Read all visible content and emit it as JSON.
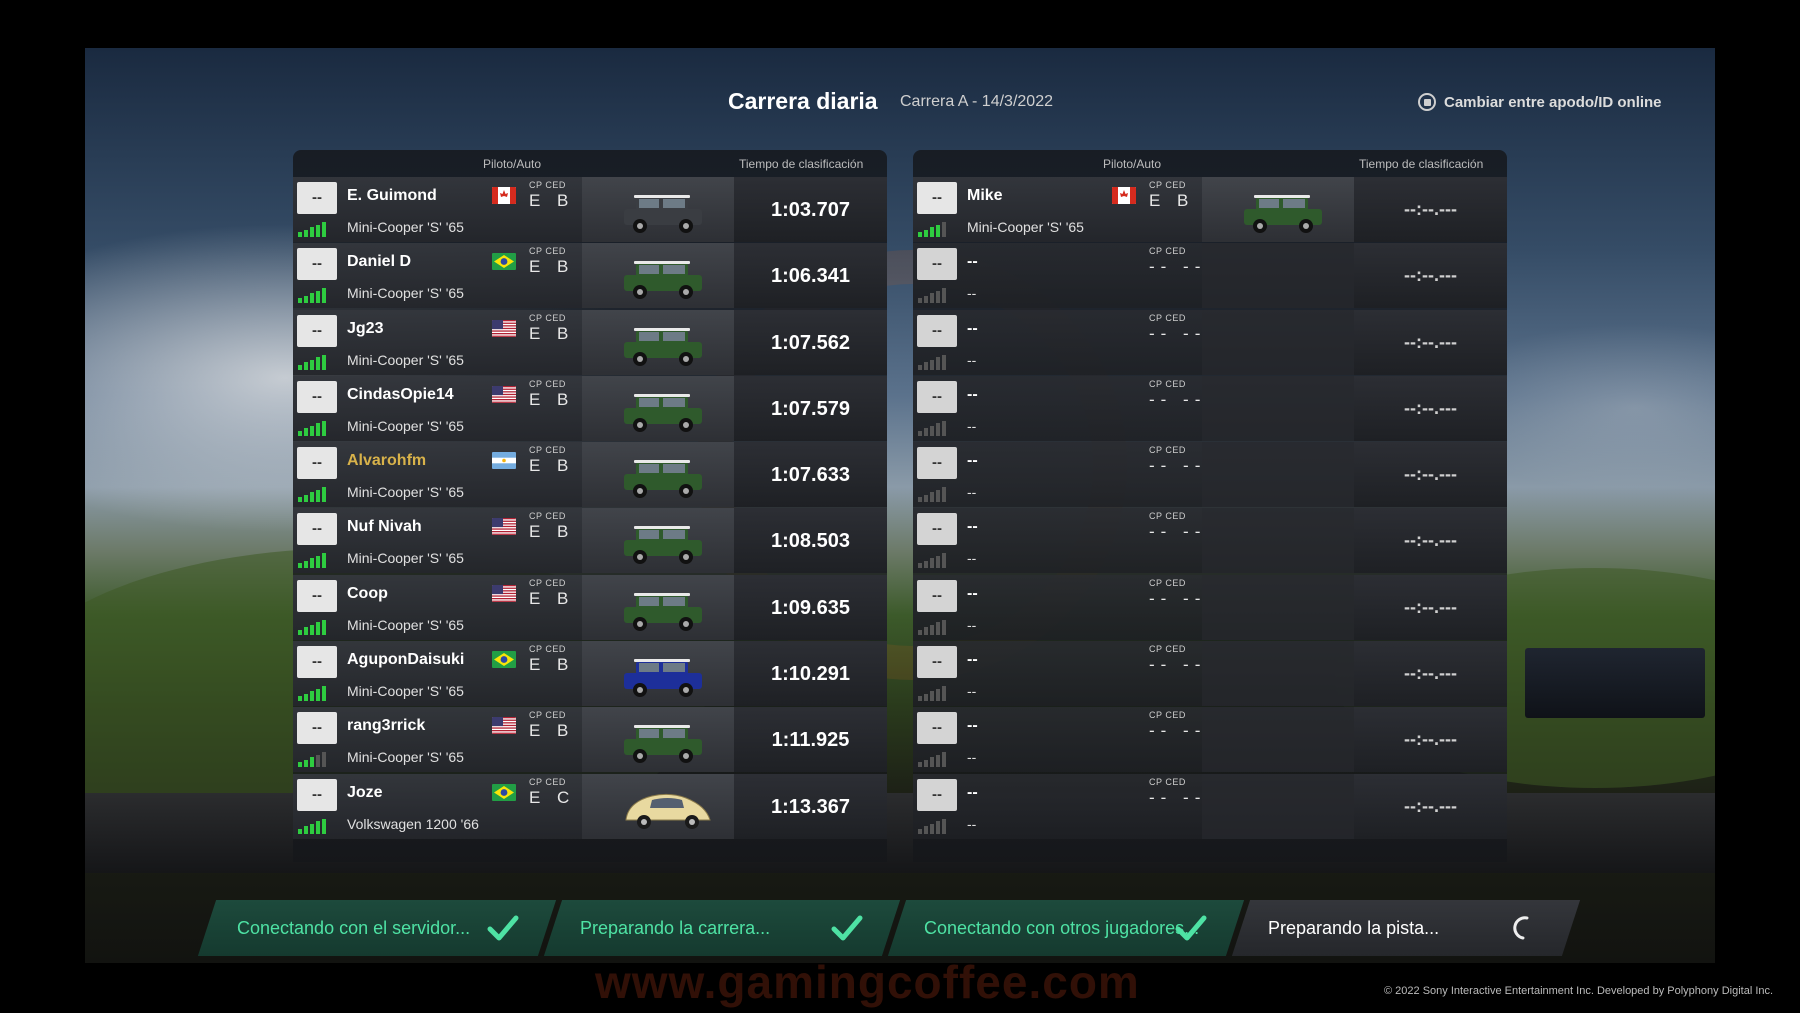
{
  "header": {
    "title": "Carrera diaria",
    "subtitle": "Carrera A - 14/3/2022",
    "toggle_label": "Cambiar entre apodo/ID online",
    "toggle_icon": "square-button-icon"
  },
  "columns": {
    "driver_car": "Piloto/Auto",
    "qualifying_time": "Tiempo de clasificación"
  },
  "stat_labels": {
    "cp": "CP",
    "ced": "CED"
  },
  "left_rows": [
    {
      "pos": "--",
      "driver": "E. Guimond",
      "flag": "canada",
      "cp": "E",
      "ced": "B",
      "car": "Mini-Cooper 'S' '65",
      "time": "1:03.707",
      "signal": 5,
      "car_color": "#3a3d42"
    },
    {
      "pos": "--",
      "driver": "Daniel D",
      "flag": "brazil",
      "cp": "E",
      "ced": "B",
      "car": "Mini-Cooper 'S' '65",
      "time": "1:06.341",
      "signal": 5,
      "car_color": "#2f5a2c"
    },
    {
      "pos": "--",
      "driver": "Jg23",
      "flag": "usa",
      "cp": "E",
      "ced": "B",
      "car": "Mini-Cooper 'S' '65",
      "time": "1:07.562",
      "signal": 5,
      "car_color": "#2f5a2c"
    },
    {
      "pos": "--",
      "driver": "CindasOpie14",
      "flag": "usa",
      "cp": "E",
      "ced": "B",
      "car": "Mini-Cooper 'S' '65",
      "time": "1:07.579",
      "signal": 5,
      "car_color": "#2f5a2c"
    },
    {
      "pos": "--",
      "driver": "Alvarohfm",
      "flag": "argentina",
      "cp": "E",
      "ced": "B",
      "car": "Mini-Cooper 'S' '65",
      "time": "1:07.633",
      "signal": 5,
      "car_color": "#2f5a2c",
      "highlight": true
    },
    {
      "pos": "--",
      "driver": "Nuf Nivah",
      "flag": "usa",
      "cp": "E",
      "ced": "B",
      "car": "Mini-Cooper 'S' '65",
      "time": "1:08.503",
      "signal": 5,
      "car_color": "#2f5a2c"
    },
    {
      "pos": "--",
      "driver": "Coop",
      "flag": "usa",
      "cp": "E",
      "ced": "B",
      "car": "Mini-Cooper 'S' '65",
      "time": "1:09.635",
      "signal": 5,
      "car_color": "#2f5a2c"
    },
    {
      "pos": "--",
      "driver": "AguponDaisuki",
      "flag": "brazil",
      "cp": "E",
      "ced": "B",
      "car": "Mini-Cooper 'S' '65",
      "time": "1:10.291",
      "signal": 5,
      "car_color": "#1d2f9a"
    },
    {
      "pos": "--",
      "driver": "rang3rrick",
      "flag": "usa",
      "cp": "E",
      "ced": "B",
      "car": "Mini-Cooper 'S' '65",
      "time": "1:11.925",
      "signal": 3,
      "car_color": "#2f5a2c"
    },
    {
      "pos": "--",
      "driver": "Joze",
      "flag": "brazil",
      "cp": "E",
      "ced": "C",
      "car": "Volkswagen 1200 '66",
      "time": "1:13.367",
      "signal": 5,
      "car_color": "#e8d9a0",
      "car_shape": "beetle"
    }
  ],
  "right_rows": [
    {
      "pos": "--",
      "driver": "Mike",
      "flag": "canada",
      "cp": "E",
      "ced": "B",
      "car": "Mini-Cooper 'S' '65",
      "time": "--:--.---",
      "signal": 4,
      "car_color": "#2f5a2c"
    },
    {
      "pos": "--",
      "driver": "--",
      "cp": "--",
      "ced": "--",
      "car": "--",
      "time": "--:--.---",
      "signal": 0
    },
    {
      "pos": "--",
      "driver": "--",
      "cp": "--",
      "ced": "--",
      "car": "--",
      "time": "--:--.---",
      "signal": 0
    },
    {
      "pos": "--",
      "driver": "--",
      "cp": "--",
      "ced": "--",
      "car": "--",
      "time": "--:--.---",
      "signal": 0
    },
    {
      "pos": "--",
      "driver": "--",
      "cp": "--",
      "ced": "--",
      "car": "--",
      "time": "--:--.---",
      "signal": 0
    },
    {
      "pos": "--",
      "driver": "--",
      "cp": "--",
      "ced": "--",
      "car": "--",
      "time": "--:--.---",
      "signal": 0
    },
    {
      "pos": "--",
      "driver": "--",
      "cp": "--",
      "ced": "--",
      "car": "--",
      "time": "--:--.---",
      "signal": 0
    },
    {
      "pos": "--",
      "driver": "--",
      "cp": "--",
      "ced": "--",
      "car": "--",
      "time": "--:--.---",
      "signal": 0
    },
    {
      "pos": "--",
      "driver": "--",
      "cp": "--",
      "ced": "--",
      "car": "--",
      "time": "--:--.---",
      "signal": 0
    },
    {
      "pos": "--",
      "driver": "--",
      "cp": "--",
      "ced": "--",
      "car": "--",
      "time": "--:--.---",
      "signal": 0
    }
  ],
  "status_steps": [
    {
      "label": "Conectando con el servidor...",
      "state": "done",
      "icon": "checkmark-icon"
    },
    {
      "label": "Preparando la carrera...",
      "state": "done",
      "icon": "checkmark-icon"
    },
    {
      "label": "Conectando con otros jugadores...",
      "state": "done",
      "icon": "checkmark-icon"
    },
    {
      "label": "Preparando la pista...",
      "state": "active",
      "icon": "loading-spinner-icon"
    }
  ],
  "colors": {
    "signal_on": "#2ecc40",
    "done_text": "#4ee2a4",
    "highlight_name": "#d8b24a"
  },
  "copyright": "© 2022 Sony Interactive Entertainment Inc. Developed by Polyphony Digital Inc.",
  "watermark": "www.gamingcoffee.com"
}
